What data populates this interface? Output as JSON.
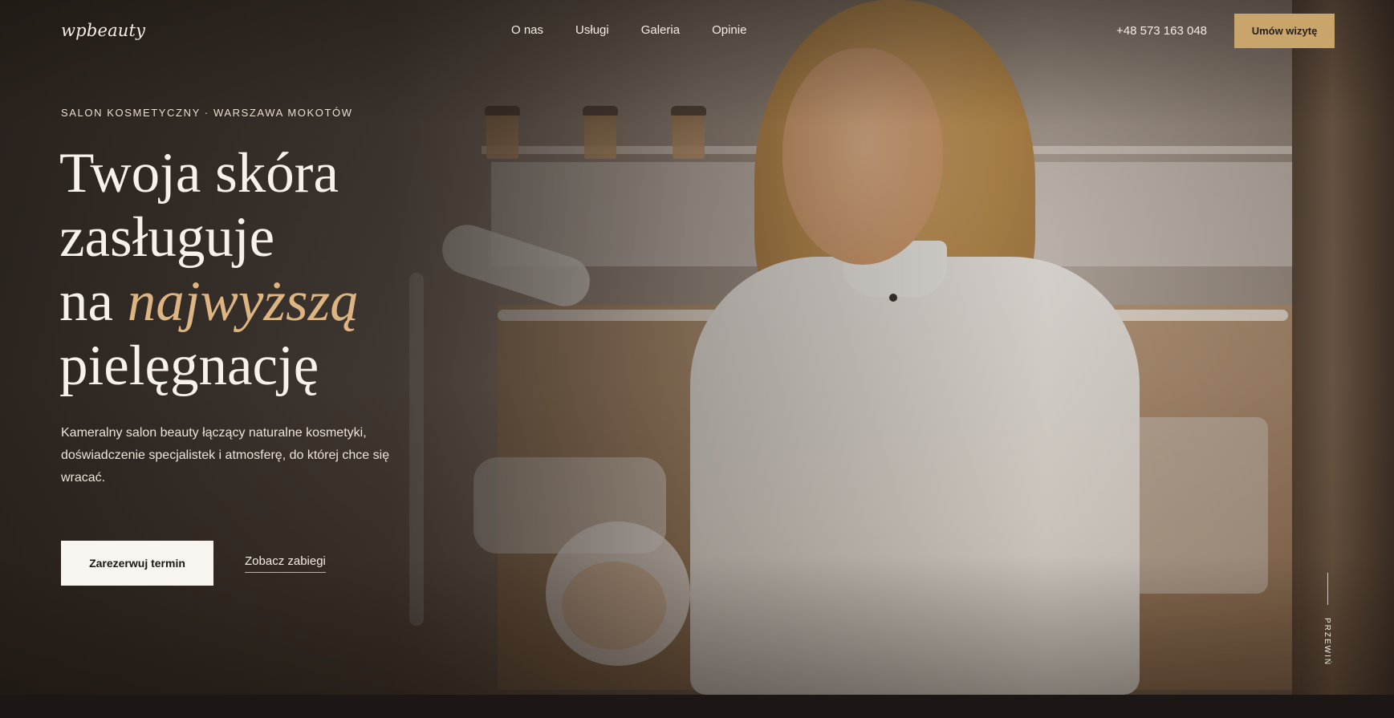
{
  "header": {
    "logo": "wpbeauty",
    "nav": [
      "O nas",
      "Usługi",
      "Galeria",
      "Opinie"
    ],
    "phone": "+48 573 163 048",
    "cta_label": "Umów wizytę"
  },
  "hero": {
    "eyebrow": "SALON KOSMETYCZNY · WARSZAWA MOKOTÓW",
    "headline_line1": "Twoja skóra",
    "headline_line2": "zasługuje",
    "headline_line3_prefix": "na ",
    "headline_line3_accent": "najwyższą",
    "headline_line4": "pielęgnację",
    "lead": "Kameralny salon beauty łączący naturalne kosmetyki, doświadczenie specjalistek i atmosferę, do której chce się wracać.",
    "primary_button": "Zarezerwuj termin",
    "secondary_link": "Zobacz zabiegi",
    "scroll_label": "PRZEWIŃ"
  },
  "colors": {
    "accent": "#c9a46b",
    "accent_text": "#ddb583",
    "dark": "#1c1714",
    "light": "#f8f5f0"
  }
}
